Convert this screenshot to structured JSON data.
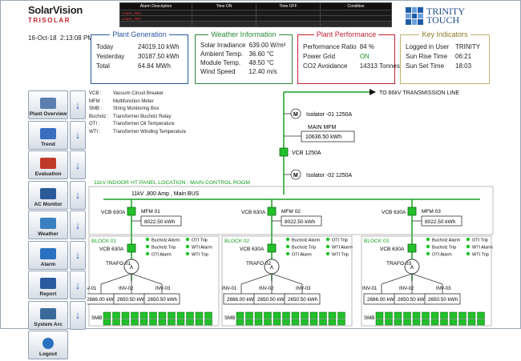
{
  "header": {
    "logo_main": "SolarVision",
    "logo_sub": "TRISOLAR",
    "brand_line1": "TRINITY",
    "brand_line2": "TOUCH",
    "alarm_columns": [
      "Alarm Description",
      "Time ON",
      "Time OFF",
      "Condition"
    ],
    "alarm_rows": [
      [
        "VCB01_TRIP",
        "",
        "",
        ""
      ],
      [
        "VCB01_TRIP",
        "",
        "",
        ""
      ]
    ],
    "date": "16-Oct-18",
    "time": "2:13:08 PM"
  },
  "panels": {
    "generation": {
      "title": "Plant Generation",
      "rows": [
        {
          "label": "Today",
          "value": "24019.10 kWh"
        },
        {
          "label": "Yesterday",
          "value": "30187.50 kWh"
        },
        {
          "label": "Total",
          "value": "64.84 MWh"
        }
      ]
    },
    "weather": {
      "title": "Weather Information",
      "rows": [
        {
          "label": "Solar Irradiance",
          "value": "639.00 W/m²"
        },
        {
          "label": "Ambient Temp.",
          "value": "36.60 °C"
        },
        {
          "label": "Module Temp.",
          "value": "48.50 °C"
        },
        {
          "label": "Wind Speed",
          "value": "12.40 m/s"
        }
      ]
    },
    "performance": {
      "title": "Plant Performance",
      "rows": [
        {
          "label": "Performance Ratio",
          "value": "84 %"
        },
        {
          "label": "Power Grid",
          "value": "ON"
        },
        {
          "label": "CO2 Avoidance",
          "value": "14313 Tonnes"
        }
      ]
    },
    "indicators": {
      "title": "Key Indicators",
      "rows": [
        {
          "label": "Logged in User",
          "value": "TRINITY"
        },
        {
          "label": "Sun Rise Time",
          "value": "06:21"
        },
        {
          "label": "Sun Set Time",
          "value": "18:03"
        }
      ]
    }
  },
  "sidebar": {
    "items": [
      {
        "label": "Plant Overview",
        "icon": "plant-overview-icon",
        "color": "#5a7fb0"
      },
      {
        "label": "Trend",
        "icon": "trend-icon",
        "color": "#3a6fc0"
      },
      {
        "label": "Evaluation",
        "icon": "evaluation-icon",
        "color": "#c03a2a"
      },
      {
        "label": "AC Monitor",
        "icon": "ac-monitor-icon",
        "color": "#2a5a9a"
      },
      {
        "label": "Weather",
        "icon": "weather-icon",
        "color": "#3a80c0"
      },
      {
        "label": "Alarm",
        "icon": "alarm-icon",
        "color": "#2a70c0"
      },
      {
        "label": "Report",
        "icon": "report-icon",
        "color": "#2a5aa0"
      },
      {
        "label": "System Arc",
        "icon": "system-arc-icon",
        "color": "#3a6a9a"
      }
    ],
    "logout": {
      "label": "Logout",
      "icon": "power-icon",
      "color": "#2a70c0"
    }
  },
  "legend": [
    {
      "abbr": "VCB :",
      "desc": "Vacuum Circuit Breaker"
    },
    {
      "abbr": "MFM :",
      "desc": "Multifunction Meter"
    },
    {
      "abbr": "SMB :",
      "desc": "String Monitoring Box"
    },
    {
      "abbr": "Bucholz :",
      "desc": "Transformer Bucholz Relay"
    },
    {
      "abbr": "OTI :",
      "desc": "Transformer Oil Temperature"
    },
    {
      "abbr": "WTI :",
      "desc": "Transformer Winding Temperature"
    }
  ],
  "sld": {
    "transmission_label": "TO 66kV TRANSMISSION LINE",
    "isolator_1": "Isolator -01 1250A",
    "isolator_2": "Isolator -02 1250A",
    "main_mfm_label": "MAIN MFM",
    "main_mfm_value": "10636.50 kWh",
    "main_vcb": "VCB 1250A",
    "panel_location": "11kV INDOOR HT PANEL LOCATION :  MAIN CONTROL ROOM",
    "main_bus": "11kV ,800 Amp , Main BUS",
    "meter_symbol": "M",
    "blocks": [
      {
        "vcb": "VCB 630A",
        "mfm": "MFM 01",
        "mfm_value": "8022.50 kWh",
        "block": "BLOCK 01",
        "vcb2": "VCB 630A",
        "trafo": "TRAFO 01",
        "inv": [
          "INV-01",
          "INV-02",
          "INV-03"
        ],
        "inv_values": [
          "2686.00 kWh",
          "2650.50 kWh",
          "2650.50 kWh"
        ]
      },
      {
        "vcb": "VCB 630A",
        "mfm": "MFM 02",
        "mfm_value": "8022.50 kWh",
        "block": "BLOCK 02",
        "vcb2": "VCB 630A",
        "trafo": "TRAFO 02",
        "inv": [
          "INV-01",
          "INV-02",
          "INV-03"
        ],
        "inv_values": [
          "2686.00 kWh",
          "2650.50 kWh",
          "2650.50 kWh"
        ]
      },
      {
        "vcb": "VCB 630A",
        "mfm": "MFM 03",
        "mfm_value": "8022.50 kWh",
        "block": "BLOCK 03",
        "vcb2": "VCB 630A",
        "trafo": "TRAFO 03",
        "inv": [
          "INV-01",
          "INV-02",
          "INV-03"
        ],
        "inv_values": [
          "2686.00 kWh",
          "2650.50 kWh",
          "2650.50 kWh"
        ]
      }
    ],
    "status_labels": [
      "Bucholz Alarm",
      "OTI Trip",
      "Bucholz Trip",
      "WTI Alarm",
      "OTI Alarm",
      "WTI Trip"
    ],
    "smb_label": "SMB",
    "smb_count": 12,
    "colors": {
      "green": "#22c02a",
      "line": "#18a020",
      "label_green": "#18a020"
    }
  }
}
